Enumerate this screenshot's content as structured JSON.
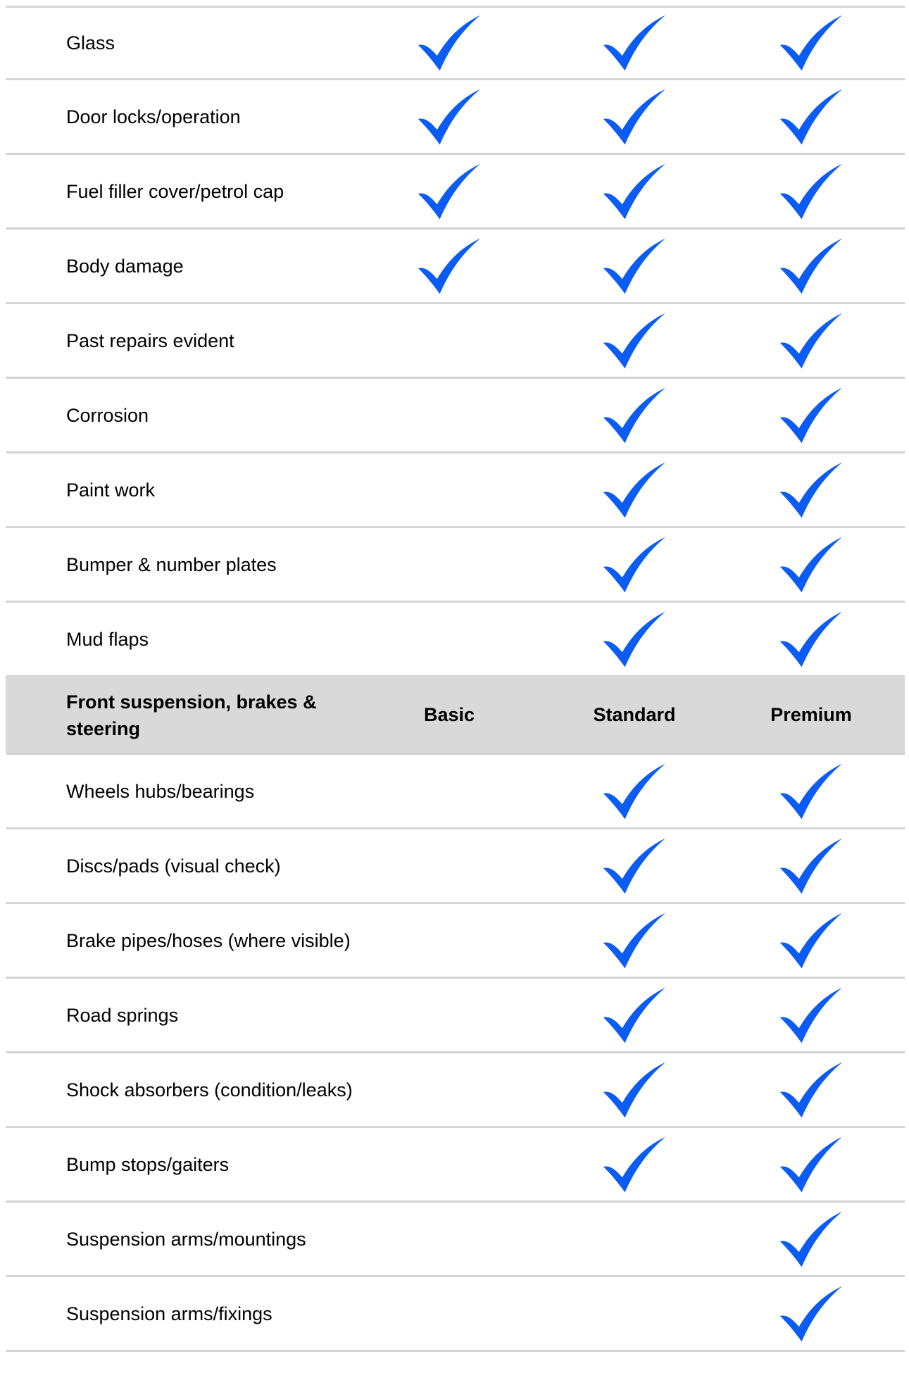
{
  "colors": {
    "check": "#0a5cf5",
    "header_bg": "#d9d9d9",
    "divider": "#d4d4d4"
  },
  "icons": {
    "check": "checkmark-icon"
  },
  "section_top": {
    "rows": [
      {
        "label": "Glass",
        "basic": true,
        "standard": true,
        "premium": true
      },
      {
        "label": "Door locks/operation",
        "basic": true,
        "standard": true,
        "premium": true
      },
      {
        "label": "Fuel filler cover/petrol cap",
        "basic": true,
        "standard": true,
        "premium": true
      },
      {
        "label": "Body damage",
        "basic": true,
        "standard": true,
        "premium": true
      },
      {
        "label": "Past repairs evident",
        "basic": false,
        "standard": true,
        "premium": true
      },
      {
        "label": "Corrosion",
        "basic": false,
        "standard": true,
        "premium": true
      },
      {
        "label": "Paint work",
        "basic": false,
        "standard": true,
        "premium": true
      },
      {
        "label": "Bumper & number plates",
        "basic": false,
        "standard": true,
        "premium": true
      },
      {
        "label": "Mud flaps",
        "basic": false,
        "standard": true,
        "premium": true
      }
    ]
  },
  "section_front": {
    "header": {
      "title": "Front suspension, brakes & steering",
      "col_basic": "Basic",
      "col_standard": "Standard",
      "col_premium": "Premium"
    },
    "rows": [
      {
        "label": "Wheels hubs/bearings",
        "basic": false,
        "standard": true,
        "premium": true
      },
      {
        "label": "Discs/pads (visual check)",
        "basic": false,
        "standard": true,
        "premium": true
      },
      {
        "label": "Brake pipes/hoses (where visible)",
        "basic": false,
        "standard": true,
        "premium": true
      },
      {
        "label": "Road springs",
        "basic": false,
        "standard": true,
        "premium": true
      },
      {
        "label": "Shock absorbers (condition/leaks)",
        "basic": false,
        "standard": true,
        "premium": true
      },
      {
        "label": "Bump stops/gaiters",
        "basic": false,
        "standard": true,
        "premium": true
      },
      {
        "label": "Suspension arms/mountings",
        "basic": false,
        "standard": false,
        "premium": true
      },
      {
        "label": "Suspension arms/fixings",
        "basic": false,
        "standard": false,
        "premium": true
      }
    ]
  }
}
